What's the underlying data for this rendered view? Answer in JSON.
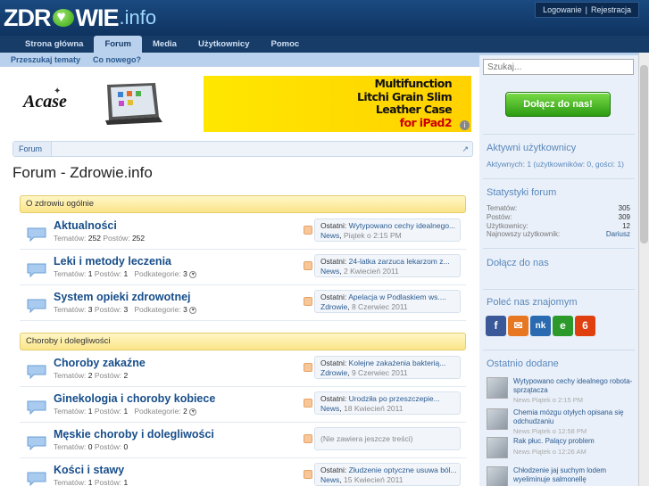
{
  "header": {
    "logo_main": "ZDR",
    "logo_rest": "WIE",
    "logo_suffix": ".info",
    "login_label": "Logowanie",
    "separator": "|",
    "register_label": "Rejestracja"
  },
  "nav": {
    "tabs": [
      "Strona główna",
      "Forum",
      "Media",
      "Użytkownicy",
      "Pomoc"
    ],
    "active": "Forum",
    "subnav": [
      "Przeszukaj tematy",
      "Co nowego?"
    ]
  },
  "banner": {
    "brand": "Acase",
    "ad_lines": [
      "Multifunction",
      "Litchi Grain Slim",
      "Leather Case",
      "for iPad2"
    ],
    "ad_icon": "i"
  },
  "breadcrumb": {
    "item": "Forum",
    "jump_icon": "↗"
  },
  "page": {
    "title": "Forum - Zdrowie.info"
  },
  "labels": {
    "topics": "Tematów:",
    "posts": "Postów:",
    "subforums": "Podkategorie:",
    "last": "Ostatni:",
    "chev": "▾"
  },
  "categories": [
    {
      "name": "O zdrowiu ogólnie",
      "forums": [
        {
          "title": "Aktualności",
          "topics": "252",
          "posts": "252",
          "subforums": "",
          "last_title": "Wytypowano cechy idealnego...",
          "last_user": "News",
          "last_date": "Piątek o 2:15 PM"
        },
        {
          "title": "Leki i metody leczenia",
          "topics": "1",
          "posts": "1",
          "subforums": "3",
          "last_title": "24-latka zarzuca lekarzom z...",
          "last_user": "News",
          "last_date": "2 Kwiecień 2011"
        },
        {
          "title": "System opieki zdrowotnej",
          "topics": "3",
          "posts": "3",
          "subforums": "3",
          "last_title": "Apelacja w Podlaskiem ws....",
          "last_user": "Zdrowie",
          "last_date": "8 Czerwiec 2011"
        }
      ]
    },
    {
      "name": "Choroby i dolegliwości",
      "forums": [
        {
          "title": "Choroby zakaźne",
          "topics": "2",
          "posts": "2",
          "subforums": "",
          "last_title": "Kolejne zakażenia bakterią...",
          "last_user": "Zdrowie",
          "last_date": "9 Czerwiec 2011"
        },
        {
          "title": "Ginekologia i choroby kobiece",
          "topics": "1",
          "posts": "1",
          "subforums": "2",
          "last_title": "Urodziła po przeszczepie...",
          "last_user": "News",
          "last_date": "18 Kwiecień 2011"
        },
        {
          "title": "Męskie choroby i dolegliwości",
          "topics": "0",
          "posts": "0",
          "subforums": "",
          "empty": "(Nie zawiera jeszcze treści)"
        },
        {
          "title": "Kości i stawy",
          "topics": "1",
          "posts": "1",
          "subforums": "",
          "last_title": "Złudzenie optyczne usuwa ból...",
          "last_user": "News",
          "last_date": "15 Kwiecień 2011"
        }
      ]
    }
  ],
  "sidebar": {
    "search_placeholder": "Szukaj...",
    "join_label": "Dołącz do nas!",
    "online_title": "Aktywni użytkownicy",
    "online_line": "Aktywnych: 1 (użytkowników: 0, gości: 1)",
    "stats_title": "Statystyki forum",
    "stats": [
      {
        "label": "Tematów:",
        "value": "305"
      },
      {
        "label": "Postów:",
        "value": "309"
      },
      {
        "label": "Użytkownicy:",
        "value": "12"
      },
      {
        "label": "Najnowszy użytkownik:",
        "value": "Dariusz"
      }
    ],
    "join_title": "Dołącz do nas",
    "share_title": "Poleć nas znajomym",
    "share_icons": [
      {
        "name": "facebook-icon",
        "glyph": "f",
        "color": "#3b5998"
      },
      {
        "name": "blip-icon",
        "glyph": "✉",
        "color": "#e87722"
      },
      {
        "name": "nk-icon",
        "glyph": "nk",
        "color": "#2a6ab0"
      },
      {
        "name": "grono-icon",
        "glyph": "e",
        "color": "#2b9a2b"
      },
      {
        "name": "wykop-icon",
        "glyph": "6",
        "color": "#e04010"
      }
    ],
    "recent_title": "Ostatnio dodane",
    "recent": [
      {
        "title": "Wytypowano cechy idealnego robota-sprzątacza",
        "user": "News",
        "date": "Piątek o 2:15 PM"
      },
      {
        "title": "Chemia mózgu otyłych opisana się odchudzaniu",
        "user": "News",
        "date": "Piątek o 12:58 PM"
      },
      {
        "title": "Rak płuc. Palący problem",
        "user": "News",
        "date": "Piątek o 12:26 AM"
      },
      {
        "title": "Chłodzenie jaj suchym lodem wyeliminuje salmonellę",
        "user": "",
        "date": ""
      }
    ]
  }
}
